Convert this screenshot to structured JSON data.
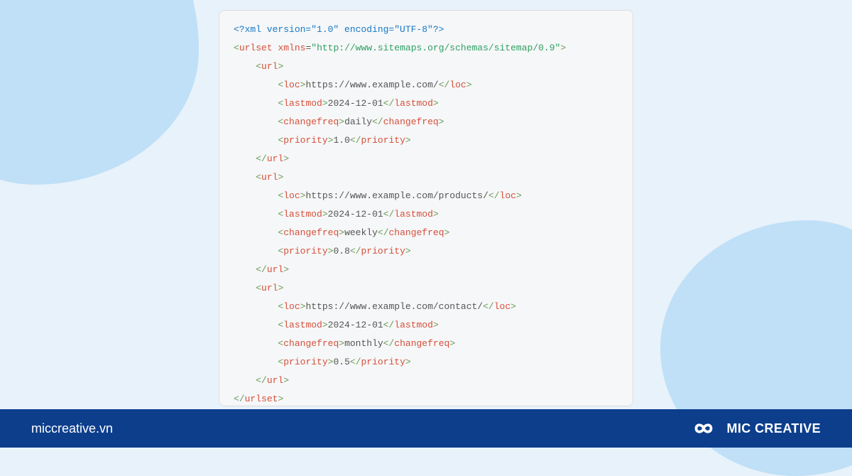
{
  "colors": {
    "page_bg": "#e8f2fb",
    "blob": "#bfe0f6",
    "panel_bg": "#f6f7f8",
    "panel_border": "#dddddd",
    "footer_bg": "#0d3e8c",
    "footer_text": "#ffffff",
    "xml_declaration": "#1679c6",
    "tag_name": "#d64f3a",
    "attr_value": "#2e9f62",
    "text": "#555555",
    "bracket": "#6a9b55"
  },
  "code": {
    "xml_declaration": "<?xml version=\"1.0\" encoding=\"UTF-8\"?>",
    "root_tag": "urlset",
    "root_attr_name": "xmlns",
    "root_attr_value": "\"http://www.sitemaps.org/schemas/sitemap/0.9\"",
    "entries": [
      {
        "loc": "https://www.example.com/",
        "lastmod": "2024-12-01",
        "changefreq": "daily",
        "priority": "1.0"
      },
      {
        "loc": "https://www.example.com/products/",
        "lastmod": "2024-12-01",
        "changefreq": "weekly",
        "priority": "0.8"
      },
      {
        "loc": "https://www.example.com/contact/",
        "lastmod": "2024-12-01",
        "changefreq": "monthly",
        "priority": "0.5"
      }
    ],
    "tags": {
      "url": "url",
      "loc": "loc",
      "lastmod": "lastmod",
      "changefreq": "changefreq",
      "priority": "priority"
    }
  },
  "footer": {
    "site": "miccreative.vn",
    "brand": "MIC CREATIVE",
    "icon_name": "infinity-icon"
  }
}
